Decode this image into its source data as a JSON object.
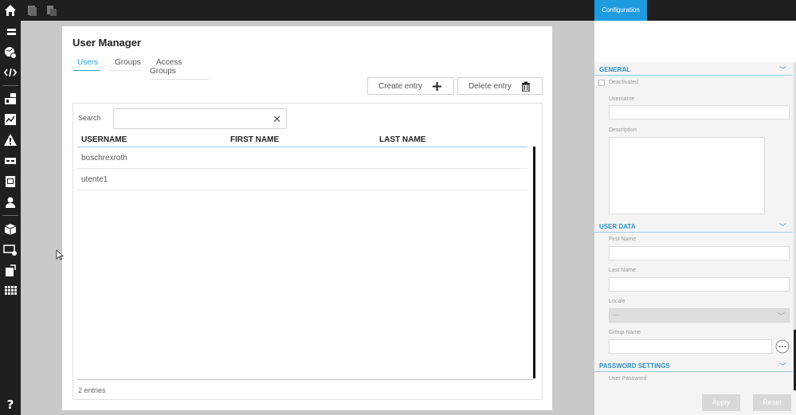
{
  "topbar": {
    "icons": [
      "home-icon",
      "copy-icon",
      "paste-icon"
    ]
  },
  "sidebar": {
    "icons": [
      "list-icon",
      "globe-icon",
      "code-icon",
      "dashboard-icon",
      "chart-icon",
      "warning-icon",
      "ticket-icon",
      "document-icon",
      "user-icon",
      "package-icon",
      "screen-settings-icon",
      "export-icon",
      "grid-icon",
      "help-icon"
    ]
  },
  "main": {
    "title": "User Manager",
    "tabs": [
      {
        "label": "Users",
        "active": true
      },
      {
        "label": "Groups",
        "active": false
      },
      {
        "label": "Access Groups",
        "active": false
      }
    ],
    "buttons": {
      "create": "Create entry",
      "delete": "Delete entry"
    },
    "search": {
      "label": "Search",
      "value": ""
    },
    "table": {
      "columns": [
        "USERNAME",
        "FIRST NAME",
        "LAST NAME"
      ],
      "rows": [
        [
          "boschrexroth",
          "",
          ""
        ],
        [
          "utente1",
          "",
          ""
        ]
      ]
    },
    "entries": "2 entries"
  },
  "config": {
    "tab": "Configuration",
    "sections": {
      "general": "GENERAL",
      "user_data": "USER DATA",
      "password_settings": "PASSWORD SETTINGS"
    },
    "fields": {
      "deactivated": "Deactivated",
      "username": "Username",
      "description": "Description",
      "first_name": "First Name",
      "last_name": "Last Name",
      "locale": "Locale",
      "locale_value": "---",
      "group_name": "Group Name",
      "user_password": "User Password"
    },
    "buttons": {
      "apply": "Apply",
      "reset": "Reset"
    }
  },
  "colors": {
    "accent": "#2aa2d8",
    "config_tab": "#1f9be0",
    "dark": "#1f1f1f"
  }
}
